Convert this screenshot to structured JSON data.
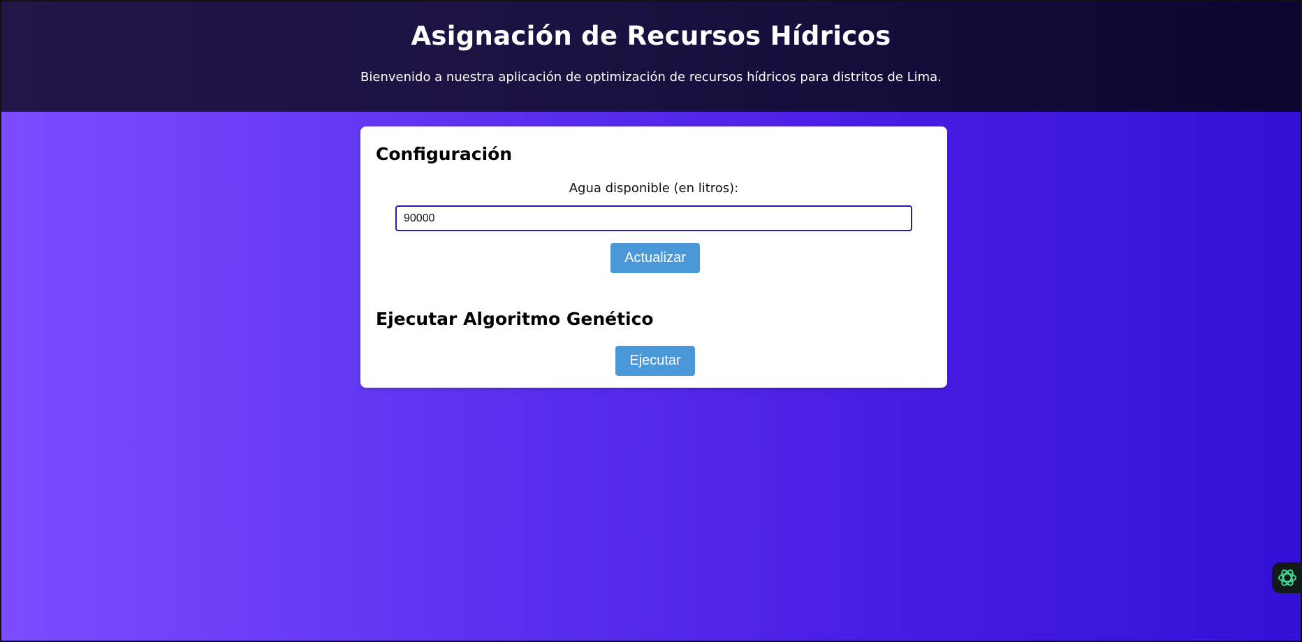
{
  "header": {
    "title": "Asignación de Recursos Hídricos",
    "subtitle": "Bienvenido a nuestra aplicación de optimización de recursos hídricos para distritos de Lima."
  },
  "config": {
    "heading": "Configuración",
    "water_label": "Agua disponible (en litros):",
    "water_value": "90000",
    "update_button": "Actualizar"
  },
  "algorithm": {
    "heading": "Ejecutar Algoritmo Genético",
    "run_button": "Ejecutar"
  },
  "assistant": {
    "icon": "openai-knot-icon",
    "color": "#3ddc97"
  },
  "colors": {
    "header_bg": "#1a1240",
    "background_left": "#7b4dff",
    "background_right": "#3310d6",
    "button": "#4a98d8",
    "input_border": "#2a1aa8"
  }
}
